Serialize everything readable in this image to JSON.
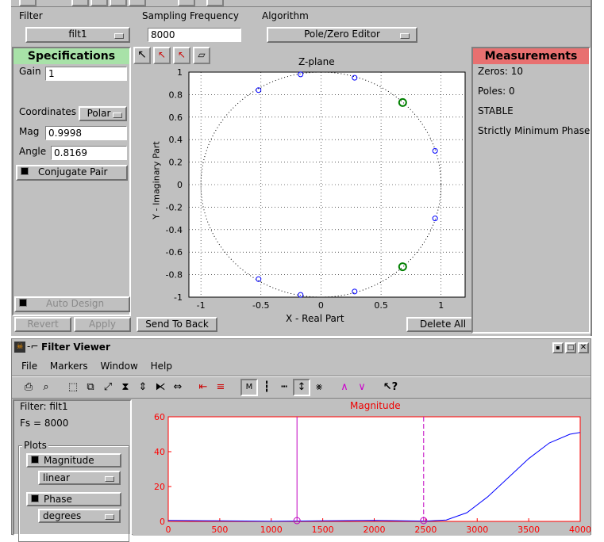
{
  "fdtool": {
    "filter_label": "Filter",
    "filter_value": "filt1",
    "fs_label": "Sampling Frequency",
    "fs_value": "8000",
    "algo_label": "Algorithm",
    "algo_value": "Pole/Zero Editor",
    "spec_title": "Specifications",
    "gain_label": "Gain",
    "gain_value": "1",
    "coord_label": "Coordinates",
    "coord_value": "Polar",
    "mag_label": "Mag",
    "mag_value": "0.9998",
    "angle_label": "Angle",
    "angle_value": "0.8169",
    "conj_label": "Conjugate Pair",
    "autodesign_label": "Auto Design",
    "revert_label": "Revert",
    "apply_label": "Apply",
    "sendback_label": "Send To Back",
    "deleteall_label": "Delete All",
    "meas_title": "Measurements",
    "zeros_line": "Zeros:  10",
    "poles_line": "Poles:  0",
    "stable_line": "STABLE",
    "phase_line": "Strictly Minimum Phase",
    "zplane": {
      "title": "Z-plane",
      "xlabel": "X - Real Part",
      "ylabel": "Y - Imaginary Part",
      "xticks": [
        "-1",
        "-0.5",
        "0",
        "0.5",
        "1"
      ],
      "yticks": [
        "1",
        "0.8",
        "0.6",
        "0.4",
        "0.2",
        "0",
        "-0.2",
        "-0.4",
        "-0.6",
        "-0.8",
        "-1"
      ]
    }
  },
  "viewer": {
    "title": "Filter Viewer",
    "menu": [
      "File",
      "Markers",
      "Window",
      "Help"
    ],
    "filter_info": "Filter: filt1",
    "fs_info": "Fs = 8000",
    "plots_label": "Plots",
    "magnitude_label": "Magnitude",
    "magnitude_scale": "linear",
    "phase_label": "Phase",
    "phase_units": "degrees",
    "plot_title": "Magnitude",
    "xticks": [
      "0",
      "500",
      "1000",
      "1500",
      "2000",
      "2500",
      "3000",
      "3500",
      "4000"
    ],
    "yticks": [
      "60",
      "40",
      "20",
      "0"
    ]
  },
  "chart_data": [
    {
      "type": "scatter",
      "title": "Z-plane",
      "xlabel": "X - Real Part",
      "ylabel": "Y - Imaginary Part",
      "xlim": [
        -1.1,
        1.2
      ],
      "ylim": [
        -1,
        1
      ],
      "grid": true,
      "unit_circle": true,
      "series": [
        {
          "name": "zeros",
          "points": [
            [
              -0.17,
              0.98
            ],
            [
              0.28,
              0.95
            ],
            [
              -0.52,
              0.84
            ],
            [
              0.95,
              0.3
            ],
            [
              0.95,
              -0.3
            ],
            [
              -0.52,
              -0.84
            ],
            [
              -0.17,
              -0.98
            ],
            [
              0.28,
              -0.95
            ]
          ]
        },
        {
          "name": "selected",
          "points": [
            [
              0.68,
              0.73
            ],
            [
              0.68,
              -0.73
            ]
          ]
        }
      ]
    },
    {
      "type": "line",
      "title": "Magnitude",
      "xlim": [
        0,
        4000
      ],
      "ylim": [
        0,
        60
      ],
      "grid": false,
      "series": [
        {
          "name": "magnitude",
          "x": [
            0,
            500,
            1000,
            1500,
            2000,
            2500,
            2700,
            2900,
            3100,
            3300,
            3500,
            3700,
            3900,
            4000
          ],
          "y": [
            0.6,
            0.3,
            0.1,
            0.3,
            0.6,
            0.2,
            0.8,
            5,
            14,
            25,
            36,
            45,
            50,
            51
          ]
        }
      ],
      "markers_x": [
        1250,
        2480
      ]
    }
  ]
}
